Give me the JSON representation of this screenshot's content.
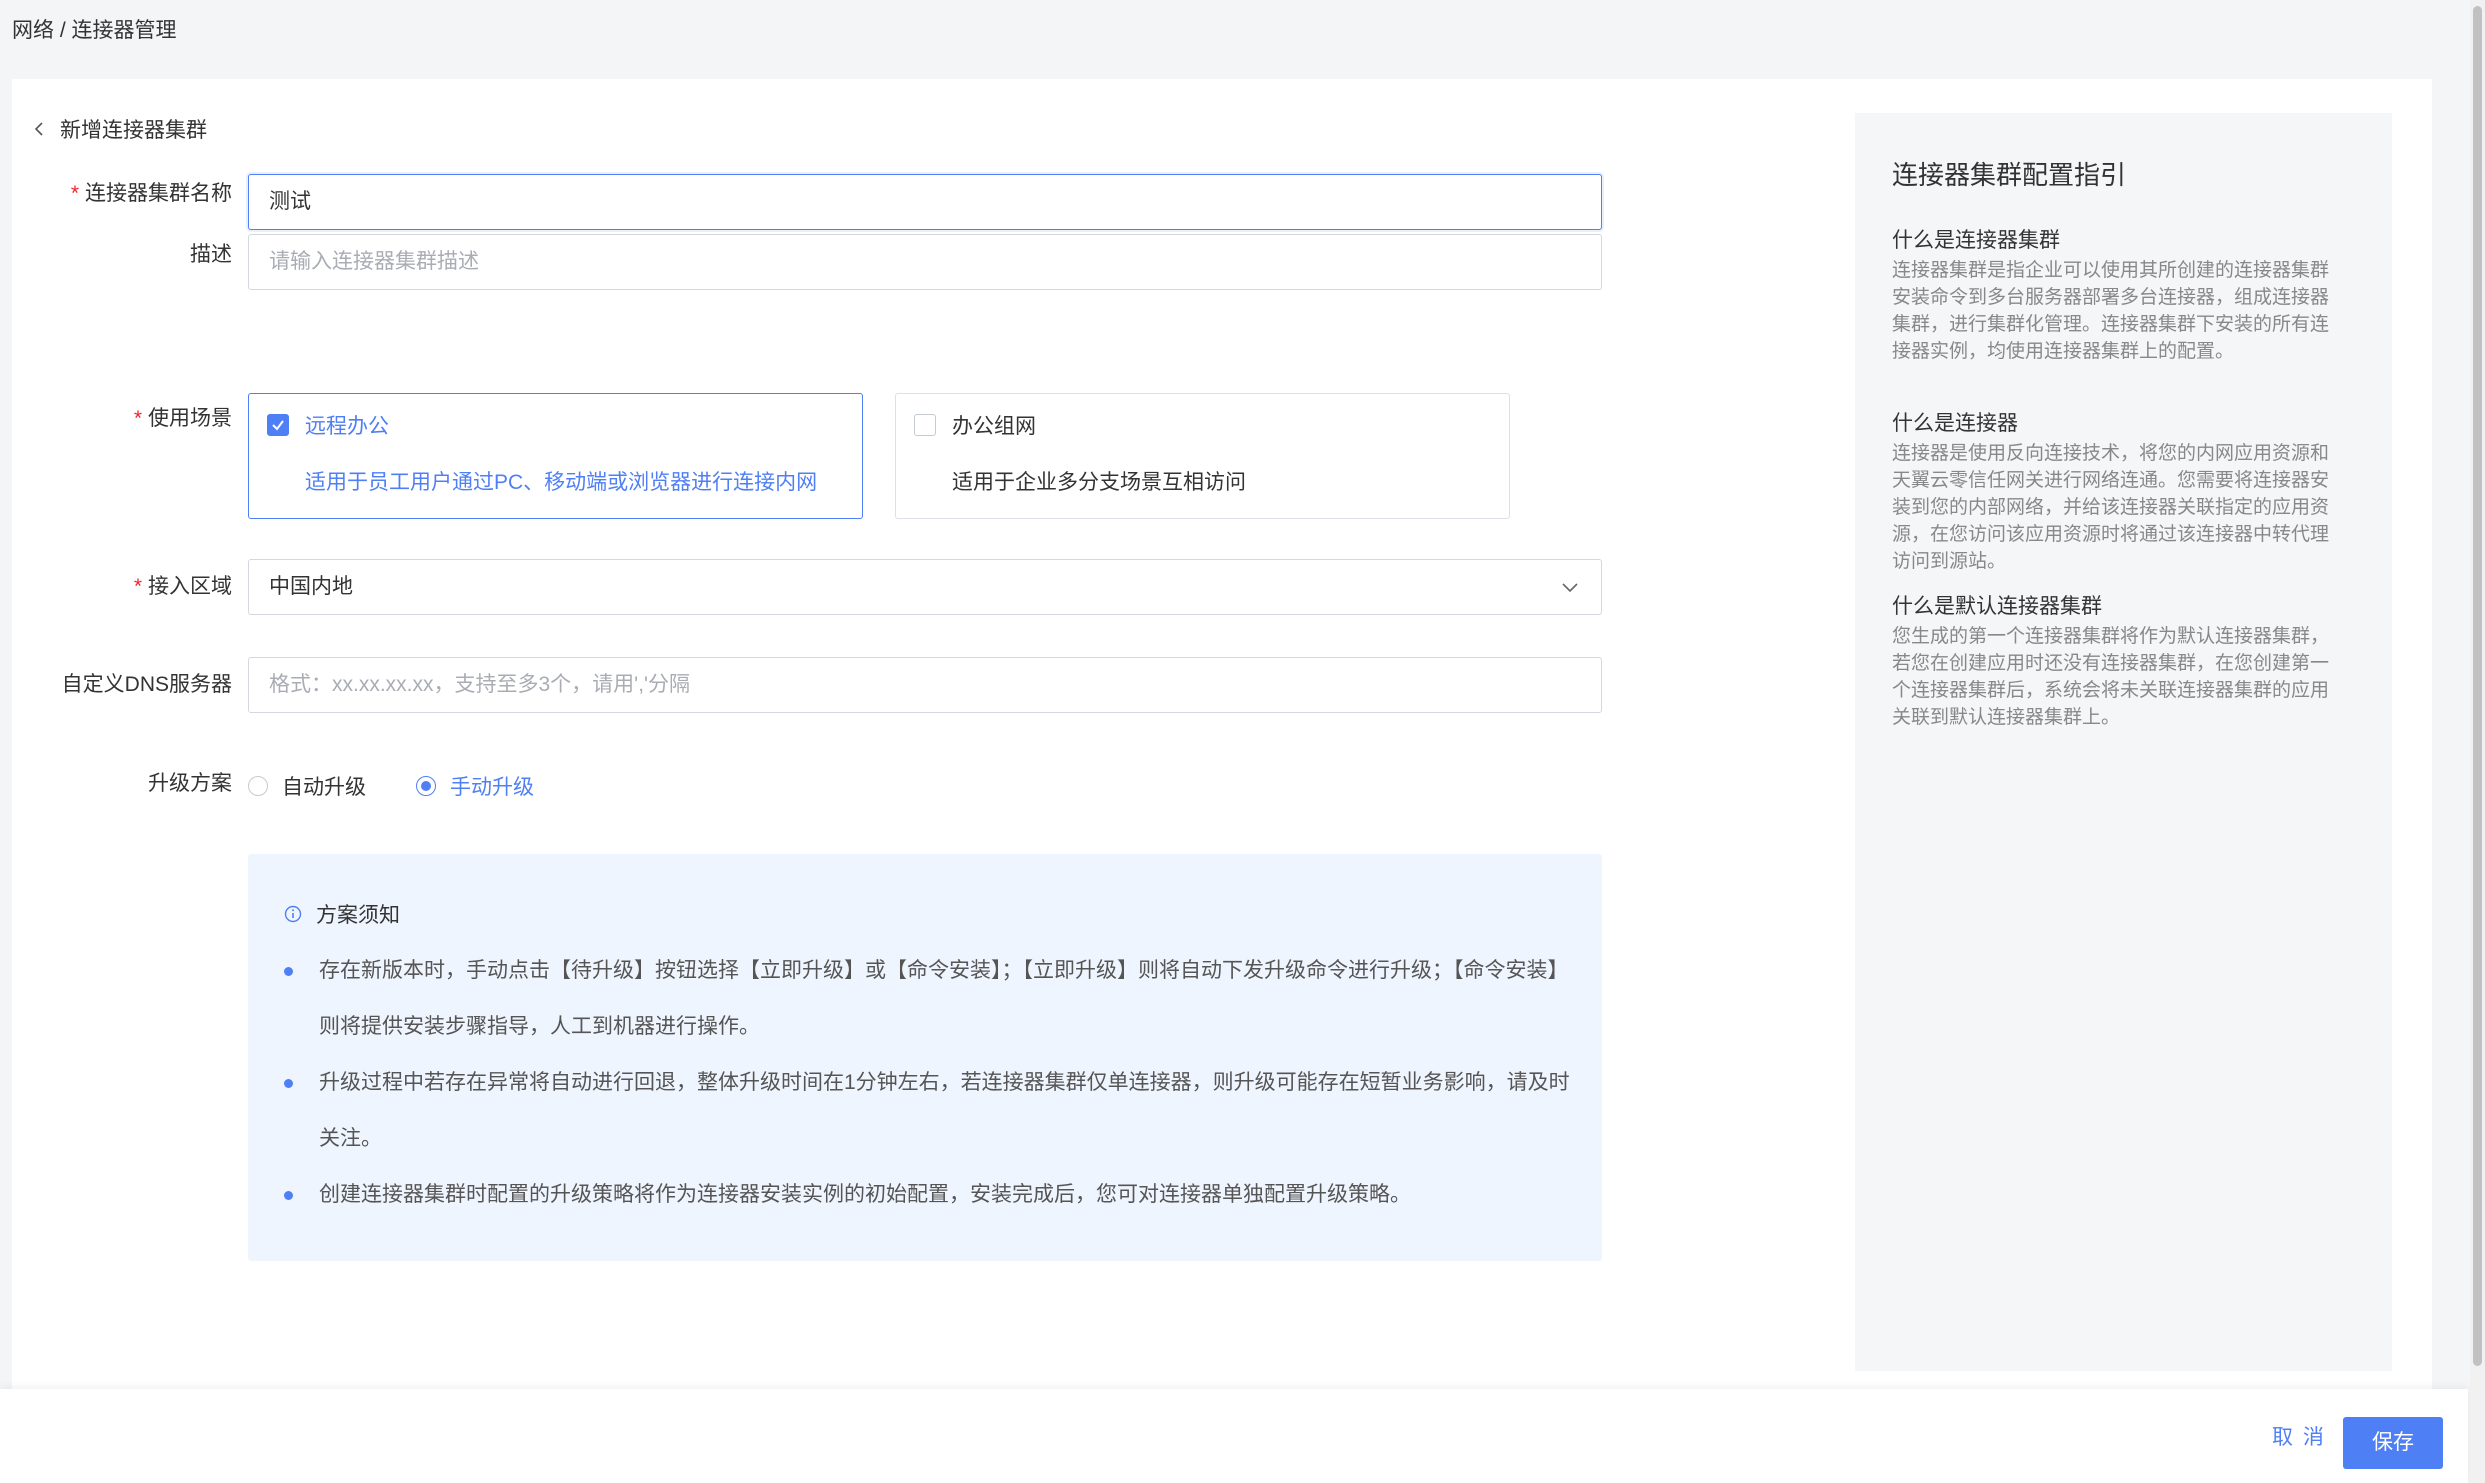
{
  "breadcrumb": "网络 / 连接器管理",
  "page": {
    "back_title": "新增连接器集群"
  },
  "form": {
    "name": {
      "label": "连接器集群名称",
      "value": "测试"
    },
    "desc": {
      "label": "描述",
      "placeholder": "请输入连接器集群描述"
    },
    "scene": {
      "label": "使用场景",
      "options": [
        {
          "title": "远程办公",
          "desc": "适用于员工用户通过PC、移动端或浏览器进行连接内网",
          "checked": true
        },
        {
          "title": "办公组网",
          "desc": "适用于企业多分支场景互相访问",
          "checked": false
        }
      ]
    },
    "region": {
      "label": "接入区域",
      "value": "中国内地"
    },
    "dns": {
      "label": "自定义DNS服务器",
      "placeholder": "格式：xx.xx.xx.xx，支持至多3个，请用','分隔"
    },
    "upgrade": {
      "label": "升级方案",
      "options": [
        {
          "label": "自动升级",
          "checked": false
        },
        {
          "label": "手动升级",
          "checked": true
        }
      ]
    }
  },
  "notice": {
    "title": "方案须知",
    "items": [
      "存在新版本时，手动点击【待升级】按钮选择【立即升级】或【命令安装】；【立即升级】则将自动下发升级命令进行升级；【命令安装】则将提供安装步骤指导，人工到机器进行操作。",
      "升级过程中若存在异常将自动进行回退，整体升级时间在1分钟左右，若连接器集群仅单连接器，则升级可能存在短暂业务影响，请及时关注。",
      "创建连接器集群时配置的升级策略将作为连接器安装实例的初始配置，安装完成后，您可对连接器单独配置升级策略。"
    ]
  },
  "guide": {
    "title": "连接器集群配置指引",
    "sections": [
      {
        "heading": "什么是连接器集群",
        "body": "连接器集群是指企业可以使用其所创建的连接器集群安装命令到多台服务器部署多台连接器，组成连接器集群，进行集群化管理。连接器集群下安装的所有连接器实例，均使用连接器集群上的配置。"
      },
      {
        "heading": "什么是连接器",
        "body": "连接器是使用反向连接技术，将您的内网应用资源和天翼云零信任网关进行网络连通。您需要将连接器安装到您的内部网络，并给该连接器关联指定的应用资源，在您访问该应用资源时将通过该连接器中转代理访问到源站。"
      },
      {
        "heading": "什么是默认连接器集群",
        "body": "您生成的第一个连接器集群将作为默认连接器集群，若您在创建应用时还没有连接器集群，在您创建第一个连接器集群后，系统会将未关联连接器集群的应用关联到默认连接器集群上。"
      }
    ]
  },
  "footer": {
    "cancel": "取 消",
    "save": "保存"
  },
  "colors": {
    "accent": "#4f7ff4",
    "required": "#f5222d",
    "notice_bg": "#eff5fe"
  }
}
